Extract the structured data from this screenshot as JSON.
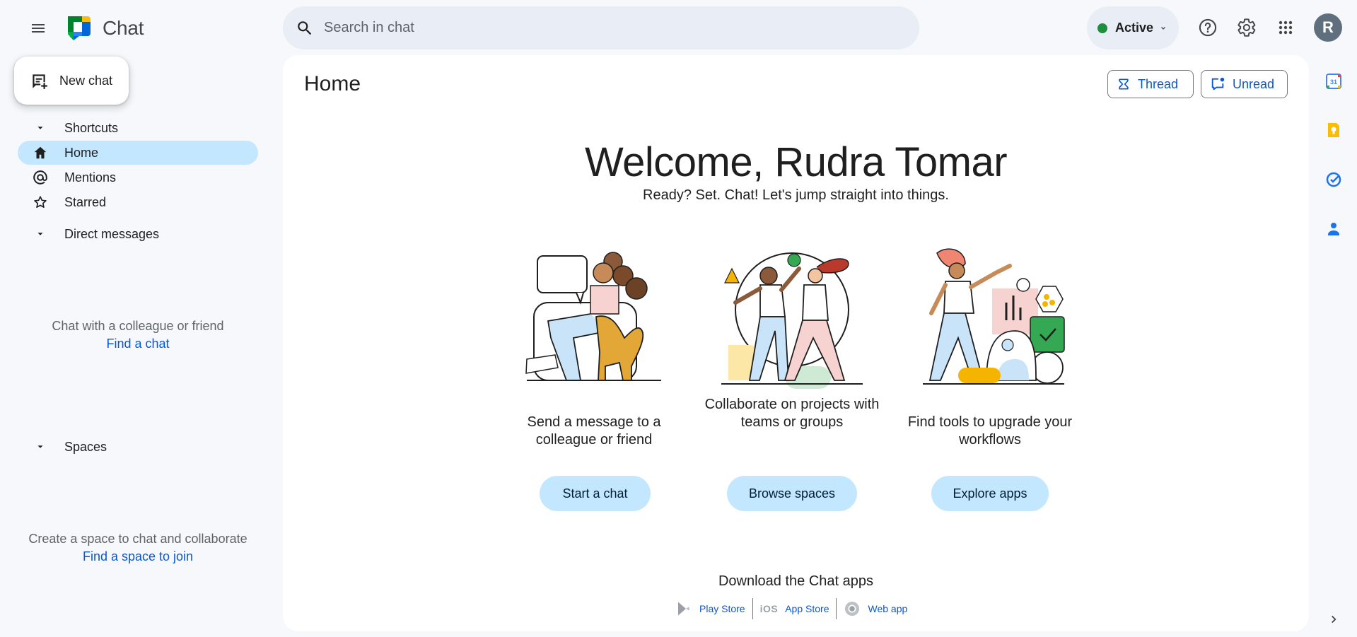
{
  "app": {
    "name": "Chat"
  },
  "search": {
    "placeholder": "Search in chat"
  },
  "status": {
    "label": "Active",
    "color": "#1e8e3e"
  },
  "user": {
    "initial": "R"
  },
  "nav": {
    "new_chat": "New chat",
    "shortcuts": {
      "label": "Shortcuts",
      "items": [
        {
          "label": "Home",
          "icon": "home-icon",
          "active": true
        },
        {
          "label": "Mentions",
          "icon": "at-icon",
          "active": false
        },
        {
          "label": "Starred",
          "icon": "star-icon",
          "active": false
        }
      ]
    },
    "direct_messages": {
      "label": "Direct messages",
      "empty_text": "Chat with a colleague or friend",
      "empty_link": "Find a chat"
    },
    "spaces": {
      "label": "Spaces",
      "empty_text": "Create a space to chat and collaborate",
      "empty_link": "Find a space to join"
    }
  },
  "main": {
    "title": "Home",
    "filters": {
      "thread": "Thread",
      "unread": "Unread"
    },
    "welcome": "Welcome, Rudra Tomar",
    "subtitle": "Ready? Set. Chat! Let's jump straight into things.",
    "cards": [
      {
        "caption": "Send a message to a colleague or friend",
        "button": "Start a chat"
      },
      {
        "caption": "Collaborate on projects with teams or groups",
        "button": "Browse spaces"
      },
      {
        "caption": "Find tools to upgrade your workflows",
        "button": "Explore apps"
      }
    ],
    "download": {
      "title": "Download the Chat apps",
      "play_store": "Play Store",
      "ios_label": "iOS",
      "app_store": "App Store",
      "web_app": "Web app"
    }
  },
  "colors": {
    "accent": "#0b57d0",
    "active_bg": "#c2e7ff",
    "page_bg": "#f6f8fc"
  }
}
